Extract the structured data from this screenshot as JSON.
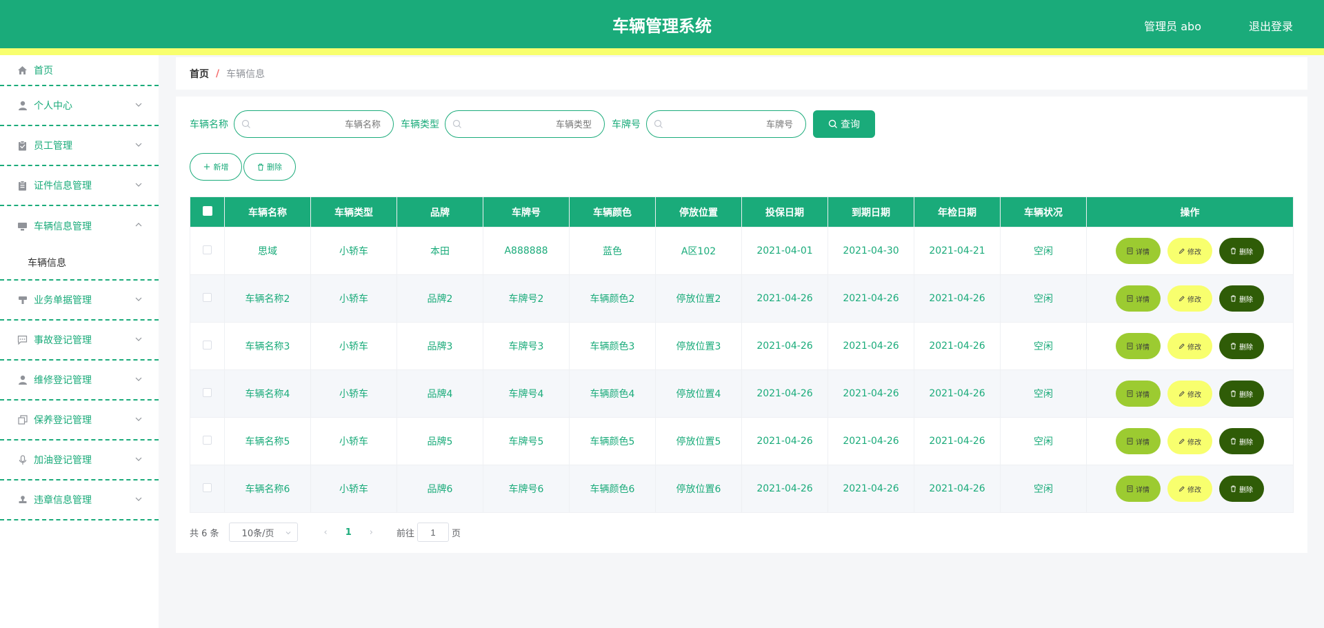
{
  "header": {
    "title": "车辆管理系统",
    "user": "管理员 abo",
    "logout": "退出登录"
  },
  "sidebar": {
    "items": [
      {
        "label": "首页",
        "icon": "home-icon"
      },
      {
        "label": "个人中心",
        "icon": "person-icon"
      },
      {
        "label": "员工管理",
        "icon": "clipboard-icon"
      },
      {
        "label": "证件信息管理",
        "icon": "clipboard-icon"
      },
      {
        "label": "车辆信息管理",
        "icon": "monitor-icon"
      },
      {
        "label": "业务单据管理",
        "icon": "stamp-icon"
      },
      {
        "label": "事故登记管理",
        "icon": "chat-icon"
      },
      {
        "label": "维修登记管理",
        "icon": "person-icon"
      },
      {
        "label": "保养登记管理",
        "icon": "copy-icon"
      },
      {
        "label": "加油登记管理",
        "icon": "mic-icon"
      },
      {
        "label": "违章信息管理",
        "icon": "stamp-icon"
      }
    ],
    "sub_item": "车辆信息"
  },
  "breadcrumb": {
    "home": "首页",
    "sep": "/",
    "current": "车辆信息"
  },
  "search": {
    "name_label": "车辆名称",
    "name_placeholder": "车辆名称",
    "type_label": "车辆类型",
    "type_placeholder": "车辆类型",
    "plate_label": "车牌号",
    "plate_placeholder": "车牌号",
    "button": "查询"
  },
  "actions": {
    "add": "新增",
    "delete": "删除"
  },
  "table": {
    "headers": [
      "车辆名称",
      "车辆类型",
      "品牌",
      "车牌号",
      "车辆颜色",
      "停放位置",
      "投保日期",
      "到期日期",
      "年检日期",
      "车辆状况",
      "操作"
    ],
    "rows": [
      [
        "思域",
        "小轿车",
        "本田",
        "A888888",
        "蓝色",
        "A区102",
        "2021-04-01",
        "2021-04-30",
        "2021-04-21",
        "空闲"
      ],
      [
        "车辆名称2",
        "小轿车",
        "品牌2",
        "车牌号2",
        "车辆颜色2",
        "停放位置2",
        "2021-04-26",
        "2021-04-26",
        "2021-04-26",
        "空闲"
      ],
      [
        "车辆名称3",
        "小轿车",
        "品牌3",
        "车牌号3",
        "车辆颜色3",
        "停放位置3",
        "2021-04-26",
        "2021-04-26",
        "2021-04-26",
        "空闲"
      ],
      [
        "车辆名称4",
        "小轿车",
        "品牌4",
        "车牌号4",
        "车辆颜色4",
        "停放位置4",
        "2021-04-26",
        "2021-04-26",
        "2021-04-26",
        "空闲"
      ],
      [
        "车辆名称5",
        "小轿车",
        "品牌5",
        "车牌号5",
        "车辆颜色5",
        "停放位置5",
        "2021-04-26",
        "2021-04-26",
        "2021-04-26",
        "空闲"
      ],
      [
        "车辆名称6",
        "小轿车",
        "品牌6",
        "车牌号6",
        "车辆颜色6",
        "停放位置6",
        "2021-04-26",
        "2021-04-26",
        "2021-04-26",
        "空闲"
      ]
    ],
    "op_labels": {
      "detail": "详情",
      "edit": "修改",
      "delete": "删除"
    }
  },
  "pagination": {
    "total": "共 6 条",
    "page_size": "10条/页",
    "current": "1",
    "goto": "前往",
    "goto_value": "1",
    "page_unit": "页"
  },
  "colors": {
    "primary": "#1aab7a",
    "accent_yellow": "#f8ff6e",
    "detail": "#9ccb31",
    "delete": "#2f5c07"
  }
}
